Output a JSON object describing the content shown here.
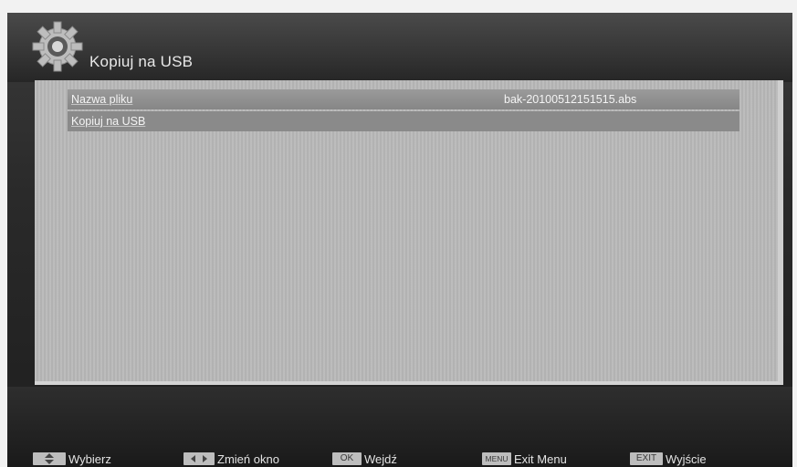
{
  "header": {
    "title": "Kopiuj na USB",
    "icon": "gear-icon"
  },
  "menu": {
    "items": [
      {
        "label": "Nazwa pliku",
        "value": "bak-20100512151515.abs"
      },
      {
        "label": "Kopiuj na USB",
        "value": ""
      }
    ]
  },
  "footer": {
    "hints": [
      {
        "key": "",
        "icon": "up-down-arrows-icon",
        "label": "Wybierz"
      },
      {
        "key": "",
        "icon": "left-right-arrows-icon",
        "label": "Zmień okno"
      },
      {
        "key": "OK",
        "label": "Wejdź"
      },
      {
        "key": "MENU",
        "label": "Exit Menu"
      },
      {
        "key": "EXIT",
        "label": "Wyjście"
      }
    ]
  }
}
